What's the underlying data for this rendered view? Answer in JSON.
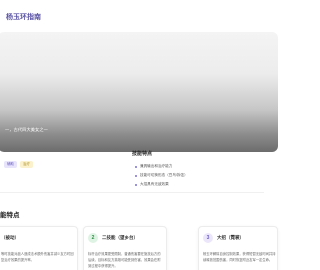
{
  "header": {
    "title": "杨玉环指南"
  },
  "hero": {
    "caption": "一，古代四大美女之一"
  },
  "tags": [
    "辅助",
    "治疗"
  ],
  "features": {
    "title": "技能特点",
    "items": [
      "兼具输出和治疗能力",
      "技能可切换形态（豆鸟/拆弦）",
      "大招具有无敌效果"
    ]
  },
  "skills_section": {
    "title": "能特点",
    "cards": [
      {
        "number": "",
        "name": "（被动）",
        "desc": "等时技能对敌人造成法术额外伤害并减少友方时回复治疗效果的提升率。"
      },
      {
        "number": "2",
        "name": "二技能（望乡台）",
        "desc": "标杆治疗效果更受限制，普通伤害要在施放后方的后续，目标和友方英雄可能受到伤害，效果会在附到过程中获得提升。"
      },
      {
        "number": "3",
        "name": "大招（霓裳）",
        "desc": "杨玉环解除自身控制效果，获得短暂无敌时间并持续释放范围伤害，同时恢复附近友军一定生命。"
      }
    ]
  },
  "colors": {
    "accent": "#5b54a6",
    "badge_purple": "#e7e4fb",
    "badge_yellow": "#fbf2cd"
  }
}
